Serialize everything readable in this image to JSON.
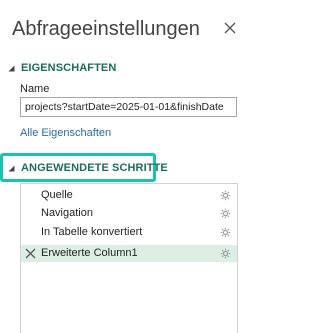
{
  "pane": {
    "title": "Abfrageeinstellungen",
    "close_icon": "close-icon"
  },
  "properties": {
    "heading": "EIGENSCHAFTEN",
    "name_label": "Name",
    "name_value": "projects?startDate=2025-01-01&finishDate",
    "all_properties_link": "Alle Eigenschaften"
  },
  "steps": {
    "heading": "ANGEWENDETE SCHRITTE",
    "items": [
      {
        "label": "Quelle",
        "has_settings": true,
        "selected": false
      },
      {
        "label": "Navigation",
        "has_settings": true,
        "selected": false
      },
      {
        "label": "In Tabelle konvertiert",
        "has_settings": true,
        "selected": false
      },
      {
        "label": "Erweiterte Column1",
        "has_settings": true,
        "selected": true
      }
    ]
  },
  "colors": {
    "section_heading": "#1e6c5a",
    "highlight_outline": "#1ec0b0",
    "selected_step_bg": "#dcefe4",
    "link": "#2b6ca3"
  }
}
